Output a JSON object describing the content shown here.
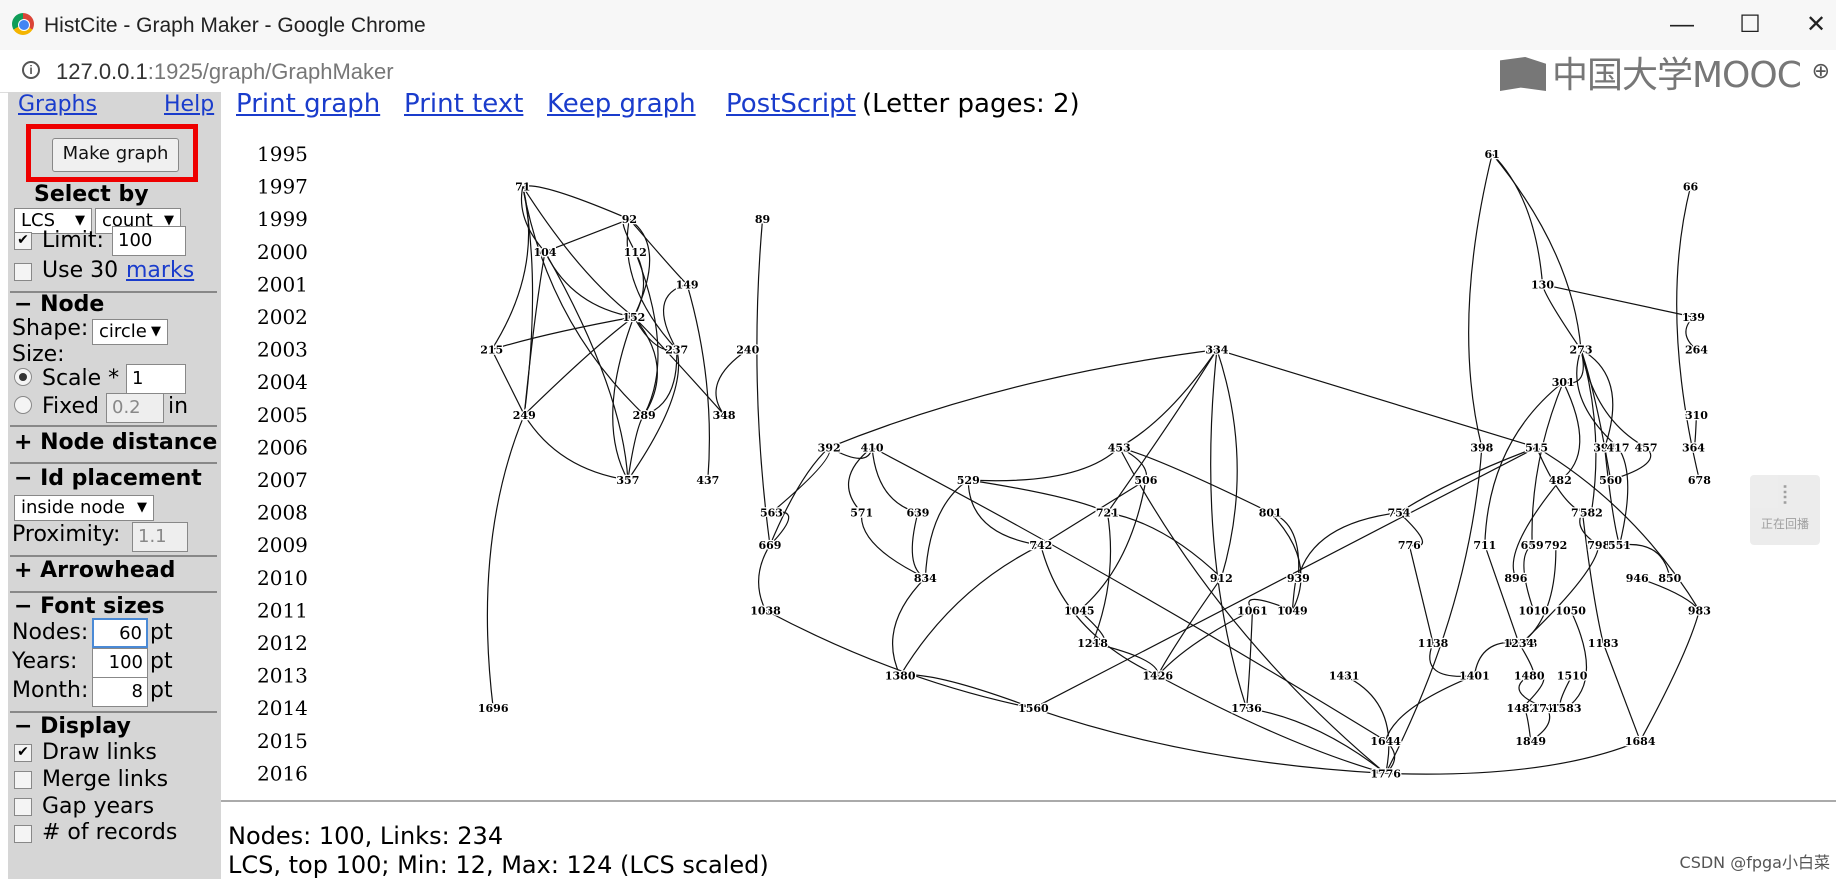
{
  "window": {
    "title": "HistCite - Graph Maker - Google Chrome",
    "minimize": "—",
    "maximize": "☐",
    "close": "✕"
  },
  "address": {
    "host": "127.0.0.1",
    "path": ":1925/graph/GraphMaker",
    "zoom_glyph": "⊕"
  },
  "overlay": {
    "logo_text": "中国大学MOOC",
    "side_tool_label": "正在回播",
    "watermark": "CSDN @fpga小白菜"
  },
  "sidebar": {
    "graphs_link": "Graphs",
    "help_link": "Help",
    "make_graph": "Make graph",
    "select_by": "Select by",
    "select_field": "LCS",
    "select_mode": "count",
    "limit_label": "Limit:",
    "limit_value": "100",
    "limit_checked": "✔",
    "use_label": "Use 30",
    "marks_link": "marks",
    "node_header": "− Node",
    "shape_label": "Shape:",
    "shape_value": "circle",
    "size_label": "Size:",
    "scale_label": "Scale *",
    "scale_value": "1",
    "fixed_label": "Fixed",
    "fixed_value": "0.2",
    "fixed_unit": "in",
    "node_distance": "+ Node distance",
    "id_placement": "− Id placement",
    "id_placement_value": "inside node",
    "proximity_label": "Proximity:",
    "proximity_value": "1.1",
    "arrowhead": "+ Arrowhead",
    "font_sizes": "− Font sizes",
    "nodes_label": "Nodes:",
    "nodes_value": "60",
    "years_label": "Years:",
    "years_value": "100",
    "month_label": "Month:",
    "month_value": "8",
    "pt": "pt",
    "display": "− Display",
    "draw_links": "Draw links",
    "draw_links_checked": "✔",
    "merge_links": "Merge links",
    "gap_years": "Gap years",
    "cut_text": "# of records"
  },
  "toolbar": {
    "print_graph": "Print graph",
    "print_text": "Print text",
    "keep_graph": "Keep graph",
    "postscript": "PostScript",
    "pages": "(Letter pages: 2)"
  },
  "graph": {
    "years": [
      "1995",
      "1997",
      "1999",
      "2000",
      "2001",
      "2002",
      "2003",
      "2004",
      "2005",
      "2006",
      "2007",
      "2008",
      "2009",
      "2010",
      "2011",
      "2012",
      "2013",
      "2014",
      "2015",
      "2016"
    ],
    "nodes": [
      {
        "id": "71",
        "year": "1997",
        "col": 0.135
      },
      {
        "id": "92",
        "year": "1999",
        "col": 0.207
      },
      {
        "id": "89",
        "year": "1999",
        "col": 0.297
      },
      {
        "id": "104",
        "year": "2000",
        "col": 0.15
      },
      {
        "id": "112",
        "year": "2000",
        "col": 0.211
      },
      {
        "id": "149",
        "year": "2001",
        "col": 0.246
      },
      {
        "id": "152",
        "year": "2002",
        "col": 0.21
      },
      {
        "id": "215",
        "year": "2003",
        "col": 0.114
      },
      {
        "id": "237",
        "year": "2003",
        "col": 0.239
      },
      {
        "id": "240",
        "year": "2003",
        "col": 0.287
      },
      {
        "id": "249",
        "year": "2005",
        "col": 0.136
      },
      {
        "id": "289",
        "year": "2005",
        "col": 0.217
      },
      {
        "id": "348",
        "year": "2005",
        "col": 0.271
      },
      {
        "id": "357",
        "year": "2007",
        "col": 0.206
      },
      {
        "id": "437",
        "year": "2007",
        "col": 0.26
      },
      {
        "id": "1696",
        "year": "2014",
        "col": 0.115
      },
      {
        "id": "334",
        "year": "2003",
        "col": 0.604
      },
      {
        "id": "392",
        "year": "2006",
        "col": 0.342
      },
      {
        "id": "410",
        "year": "2006",
        "col": 0.371
      },
      {
        "id": "453",
        "year": "2006",
        "col": 0.538
      },
      {
        "id": "515",
        "year": "2006",
        "col": 0.82
      },
      {
        "id": "529",
        "year": "2007",
        "col": 0.436
      },
      {
        "id": "506",
        "year": "2007",
        "col": 0.556
      },
      {
        "id": "563",
        "year": "2008",
        "col": 0.303
      },
      {
        "id": "571",
        "year": "2008",
        "col": 0.364
      },
      {
        "id": "639",
        "year": "2008",
        "col": 0.402
      },
      {
        "id": "721",
        "year": "2008",
        "col": 0.53
      },
      {
        "id": "754",
        "year": "2008",
        "col": 0.727
      },
      {
        "id": "779",
        "year": "2008",
        "col": 0.851
      },
      {
        "id": "801",
        "year": "2008",
        "col": 0.64
      },
      {
        "id": "669",
        "year": "2009",
        "col": 0.302
      },
      {
        "id": "742",
        "year": "2009",
        "col": 0.485
      },
      {
        "id": "776",
        "year": "2009",
        "col": 0.734
      },
      {
        "id": "792",
        "year": "2009",
        "col": 0.833
      },
      {
        "id": "798",
        "year": "2009",
        "col": 0.862
      },
      {
        "id": "834",
        "year": "2010",
        "col": 0.407
      },
      {
        "id": "912",
        "year": "2010",
        "col": 0.607
      },
      {
        "id": "939",
        "year": "2010",
        "col": 0.659
      },
      {
        "id": "946",
        "year": "2010",
        "col": 0.888
      },
      {
        "id": "1038",
        "year": "2011",
        "col": 0.299
      },
      {
        "id": "1045",
        "year": "2011",
        "col": 0.511
      },
      {
        "id": "1049",
        "year": "2011",
        "col": 0.655
      },
      {
        "id": "1061",
        "year": "2011",
        "col": 0.628
      },
      {
        "id": "983",
        "year": "2011",
        "col": 0.93
      },
      {
        "id": "1218",
        "year": "2012",
        "col": 0.52
      },
      {
        "id": "1138",
        "year": "2012",
        "col": 0.75
      },
      {
        "id": "1178",
        "year": "2012",
        "col": 0.81
      },
      {
        "id": "1183",
        "year": "2012",
        "col": 0.865
      },
      {
        "id": "1380",
        "year": "2013",
        "col": 0.39
      },
      {
        "id": "1426",
        "year": "2013",
        "col": 0.564
      },
      {
        "id": "1431",
        "year": "2013",
        "col": 0.69
      },
      {
        "id": "1401",
        "year": "2013",
        "col": 0.778
      },
      {
        "id": "1560",
        "year": "2014",
        "col": 0.48
      },
      {
        "id": "1736",
        "year": "2014",
        "col": 0.624
      },
      {
        "id": "1644",
        "year": "2015",
        "col": 0.718
      },
      {
        "id": "1684",
        "year": "2015",
        "col": 0.89
      },
      {
        "id": "1776",
        "year": "2016",
        "col": 0.718
      },
      {
        "id": "61",
        "year": "1995",
        "col": 0.79
      },
      {
        "id": "66",
        "year": "1997",
        "col": 0.924
      },
      {
        "id": "130",
        "year": "2001",
        "col": 0.824
      },
      {
        "id": "139",
        "year": "2002",
        "col": 0.926
      },
      {
        "id": "264",
        "year": "2003",
        "col": 0.928
      },
      {
        "id": "273",
        "year": "2003",
        "col": 0.85
      },
      {
        "id": "301",
        "year": "2004",
        "col": 0.838
      },
      {
        "id": "310",
        "year": "2005",
        "col": 0.928
      },
      {
        "id": "398",
        "year": "2006",
        "col": 0.783
      },
      {
        "id": "394",
        "year": "2006",
        "col": 0.866
      },
      {
        "id": "417",
        "year": "2006",
        "col": 0.875
      },
      {
        "id": "457",
        "year": "2006",
        "col": 0.894
      },
      {
        "id": "364",
        "year": "2006",
        "col": 0.926
      },
      {
        "id": "482",
        "year": "2007",
        "col": 0.836
      },
      {
        "id": "560",
        "year": "2007",
        "col": 0.87
      },
      {
        "id": "678",
        "year": "2007",
        "col": 0.93
      },
      {
        "id": "582",
        "year": "2008",
        "col": 0.857
      },
      {
        "id": "551",
        "year": "2009",
        "col": 0.876
      },
      {
        "id": "711",
        "year": "2009",
        "col": 0.785
      },
      {
        "id": "659",
        "year": "2009",
        "col": 0.817
      },
      {
        "id": "896",
        "year": "2010",
        "col": 0.806
      },
      {
        "id": "850",
        "year": "2010",
        "col": 0.91
      },
      {
        "id": "1010",
        "year": "2011",
        "col": 0.818
      },
      {
        "id": "1050",
        "year": "2011",
        "col": 0.843
      },
      {
        "id": "1234",
        "year": "2012",
        "col": 0.808
      },
      {
        "id": "1480",
        "year": "2013",
        "col": 0.815
      },
      {
        "id": "1510",
        "year": "2013",
        "col": 0.844
      },
      {
        "id": "1482",
        "year": "2014",
        "col": 0.81
      },
      {
        "id": "1717",
        "year": "2014",
        "col": 0.827
      },
      {
        "id": "1583",
        "year": "2014",
        "col": 0.84
      },
      {
        "id": "1849",
        "year": "2015",
        "col": 0.816
      }
    ],
    "links": [
      [
        "71",
        "92"
      ],
      [
        "71",
        "104"
      ],
      [
        "71",
        "152"
      ],
      [
        "71",
        "249"
      ],
      [
        "71",
        "215"
      ],
      [
        "71",
        "289"
      ],
      [
        "92",
        "112"
      ],
      [
        "92",
        "104"
      ],
      [
        "92",
        "149"
      ],
      [
        "92",
        "152"
      ],
      [
        "92",
        "237"
      ],
      [
        "104",
        "152"
      ],
      [
        "104",
        "249"
      ],
      [
        "112",
        "152"
      ],
      [
        "112",
        "289"
      ],
      [
        "149",
        "237"
      ],
      [
        "152",
        "215"
      ],
      [
        "152",
        "237"
      ],
      [
        "152",
        "249"
      ],
      [
        "152",
        "289"
      ],
      [
        "152",
        "357"
      ],
      [
        "152",
        "348"
      ],
      [
        "215",
        "249"
      ],
      [
        "237",
        "289"
      ],
      [
        "237",
        "357"
      ],
      [
        "240",
        "348"
      ],
      [
        "249",
        "357"
      ],
      [
        "289",
        "357"
      ],
      [
        "149",
        "437"
      ],
      [
        "104",
        "357"
      ],
      [
        "249",
        "1696"
      ],
      [
        "89",
        "669"
      ],
      [
        "334",
        "453"
      ],
      [
        "334",
        "721"
      ],
      [
        "334",
        "912"
      ],
      [
        "334",
        "1736"
      ],
      [
        "334",
        "392"
      ],
      [
        "334",
        "515"
      ],
      [
        "392",
        "410"
      ],
      [
        "392",
        "563"
      ],
      [
        "410",
        "571"
      ],
      [
        "410",
        "639"
      ],
      [
        "392",
        "669"
      ],
      [
        "453",
        "506"
      ],
      [
        "453",
        "529"
      ],
      [
        "453",
        "801"
      ],
      [
        "515",
        "754"
      ],
      [
        "515",
        "779"
      ],
      [
        "515",
        "983"
      ],
      [
        "529",
        "721"
      ],
      [
        "529",
        "742"
      ],
      [
        "529",
        "834"
      ],
      [
        "506",
        "742"
      ],
      [
        "506",
        "1045"
      ],
      [
        "563",
        "669"
      ],
      [
        "571",
        "834"
      ],
      [
        "639",
        "834"
      ],
      [
        "721",
        "912"
      ],
      [
        "721",
        "1218"
      ],
      [
        "754",
        "776"
      ],
      [
        "754",
        "939"
      ],
      [
        "779",
        "798"
      ],
      [
        "779",
        "1183"
      ],
      [
        "801",
        "939"
      ],
      [
        "801",
        "1049"
      ],
      [
        "742",
        "1426"
      ],
      [
        "742",
        "1380"
      ],
      [
        "776",
        "1138"
      ],
      [
        "792",
        "1178"
      ],
      [
        "798",
        "1178"
      ],
      [
        "834",
        "1380"
      ],
      [
        "912",
        "1426"
      ],
      [
        "939",
        "1049"
      ],
      [
        "946",
        "983"
      ],
      [
        "1045",
        "1218"
      ],
      [
        "1049",
        "1061"
      ],
      [
        "1061",
        "1426"
      ],
      [
        "1061",
        "1736"
      ],
      [
        "983",
        "1684"
      ],
      [
        "1218",
        "1426"
      ],
      [
        "1138",
        "1401"
      ],
      [
        "1178",
        "1401"
      ],
      [
        "1183",
        "1684"
      ],
      [
        "1426",
        "1776"
      ],
      [
        "1431",
        "1776"
      ],
      [
        "1401",
        "1644"
      ],
      [
        "1560",
        "1776"
      ],
      [
        "1736",
        "1776"
      ],
      [
        "1644",
        "1776"
      ],
      [
        "1684",
        "1776"
      ],
      [
        "1380",
        "1560"
      ],
      [
        "669",
        "1038"
      ],
      [
        "1038",
        "1560"
      ],
      [
        "61",
        "130"
      ],
      [
        "61",
        "273"
      ],
      [
        "61",
        "398"
      ],
      [
        "130",
        "273"
      ],
      [
        "130",
        "139"
      ],
      [
        "273",
        "301"
      ],
      [
        "273",
        "394"
      ],
      [
        "273",
        "417"
      ],
      [
        "273",
        "457"
      ],
      [
        "273",
        "560"
      ],
      [
        "273",
        "582"
      ],
      [
        "301",
        "482"
      ],
      [
        "301",
        "711"
      ],
      [
        "301",
        "659"
      ],
      [
        "394",
        "551"
      ],
      [
        "417",
        "551"
      ],
      [
        "457",
        "560"
      ],
      [
        "482",
        "896"
      ],
      [
        "659",
        "1010"
      ],
      [
        "711",
        "1234"
      ],
      [
        "1234",
        "1480"
      ],
      [
        "1480",
        "1482"
      ],
      [
        "1480",
        "1717"
      ],
      [
        "1510",
        "1583"
      ],
      [
        "1482",
        "1849"
      ],
      [
        "1717",
        "1849"
      ],
      [
        "1050",
        "1583"
      ],
      [
        "66",
        "678"
      ],
      [
        "139",
        "264"
      ],
      [
        "310",
        "364"
      ],
      [
        "850",
        "551"
      ],
      [
        "398",
        "1776"
      ],
      [
        "453",
        "1776"
      ],
      [
        "410",
        "1644"
      ],
      [
        "515",
        "1560"
      ]
    ],
    "col_width": 1480,
    "stroke": "#111"
  },
  "stats": {
    "line1": "Nodes: 100, Links: 234",
    "line2": "LCS, top 100; Min: 12, Max: 124 (LCS scaled)"
  }
}
